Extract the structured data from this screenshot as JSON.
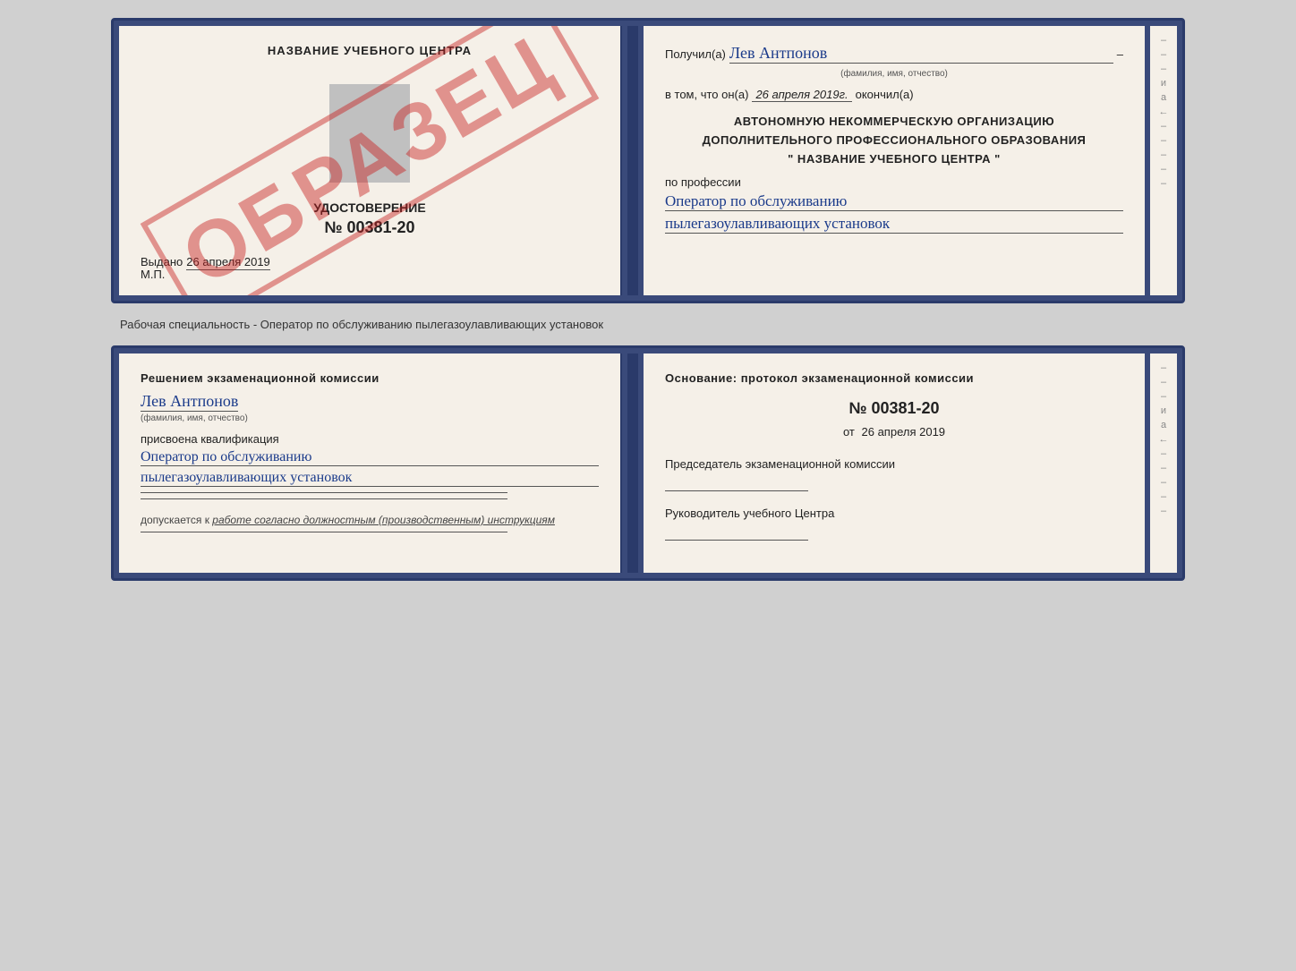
{
  "top_cert": {
    "left": {
      "title": "НАЗВАНИЕ УЧЕБНОГО ЦЕНТРА",
      "watermark": "ОБРАЗЕЦ",
      "cert_type_label": "УДОСТОВЕРЕНИЕ",
      "cert_number": "№ 00381-20",
      "issued_label": "Выдано",
      "issued_date": "26 апреля 2019",
      "mp_label": "М.П."
    },
    "right": {
      "received_label": "Получил(а)",
      "recipient_name": "Лев Антпонов",
      "fio_hint": "(фамилия, имя, отчество)",
      "date_prefix": "в том, что он(а)",
      "date_value": "26 апреля 2019г.",
      "date_suffix": "окончил(а)",
      "org_line1": "АВТОНОМНУЮ НЕКОММЕРЧЕСКУЮ ОРГАНИЗАЦИЮ",
      "org_line2": "ДОПОЛНИТЕЛЬНОГО ПРОФЕССИОНАЛЬНОГО ОБРАЗОВАНИЯ",
      "org_line3": "\"   НАЗВАНИЕ УЧЕБНОГО ЦЕНТРА   \"",
      "profession_label": "по профессии",
      "profession_line1": "Оператор по обслуживанию",
      "profession_line2": "пылегазоулавливающих установок"
    }
  },
  "separator_text": "Рабочая специальность - Оператор по обслуживанию пылегазоулавливающих установок",
  "bottom_cert": {
    "left": {
      "commission_title": "Решением экзаменационной комиссии",
      "person_name": "Лев Антпонов",
      "fio_hint": "(фамилия, имя, отчество)",
      "qualification_label": "присвоена квалификация",
      "qualification_line1": "Оператор по обслуживанию",
      "qualification_line2": "пылегазоулавливающих установок",
      "work_admission_prefix": "допускается к",
      "work_admission_value": "работе согласно должностным (производственным) инструкциям"
    },
    "right": {
      "basis_title": "Основание: протокол экзаменационной комиссии",
      "protocol_number": "№  00381-20",
      "protocol_date_prefix": "от",
      "protocol_date_value": "26 апреля 2019",
      "chairman_label": "Председатель экзаменационной комиссии",
      "director_label": "Руководитель учебного Центра"
    }
  },
  "margin_symbols": [
    "–",
    "–",
    "и",
    "а",
    "←",
    "–",
    "–",
    "–",
    "–",
    "–"
  ]
}
